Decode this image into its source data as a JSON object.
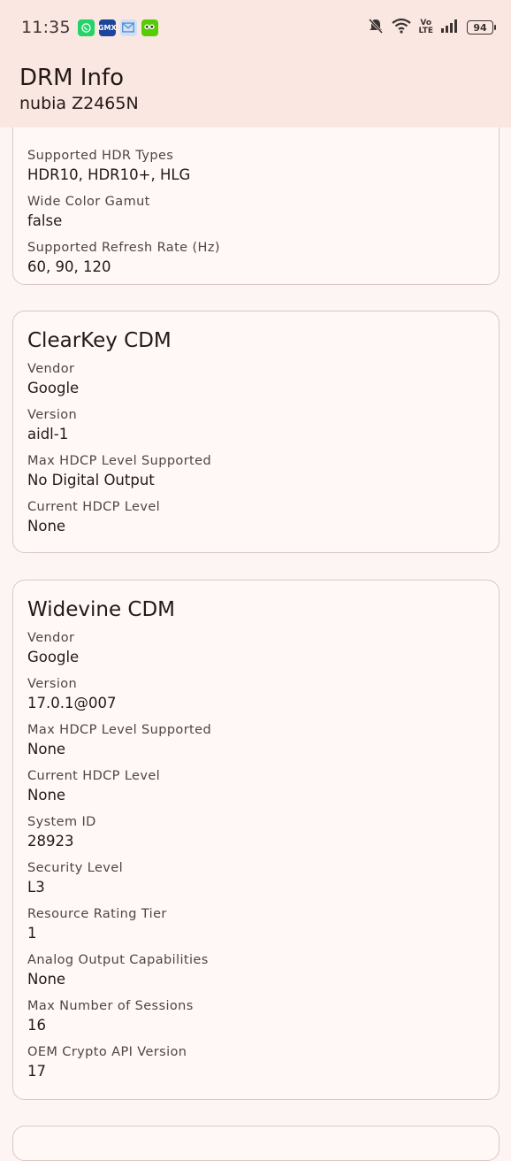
{
  "status_bar": {
    "time": "11:35",
    "battery": "94",
    "network_badge": "Vo\nLTE",
    "notification_icons": [
      "whatsapp-icon",
      "gmx-icon",
      "mail-icon",
      "duolingo-icon"
    ]
  },
  "app_bar": {
    "title": "DRM Info",
    "subtitle": "nubia Z2465N"
  },
  "display_card": {
    "fields": [
      {
        "label": "Supported HDR Types",
        "value": "HDR10, HDR10+, HLG"
      },
      {
        "label": "Wide Color Gamut",
        "value": "false"
      },
      {
        "label": "Supported Refresh Rate (Hz)",
        "value": "60, 90, 120"
      }
    ]
  },
  "clearkey_card": {
    "title": "ClearKey CDM",
    "fields": [
      {
        "label": "Vendor",
        "value": "Google"
      },
      {
        "label": "Version",
        "value": "aidl-1"
      },
      {
        "label": "Max HDCP Level Supported",
        "value": "No Digital Output"
      },
      {
        "label": "Current HDCP Level",
        "value": "None"
      }
    ]
  },
  "widevine_card": {
    "title": "Widevine CDM",
    "fields": [
      {
        "label": "Vendor",
        "value": "Google"
      },
      {
        "label": "Version",
        "value": "17.0.1@007"
      },
      {
        "label": "Max HDCP Level Supported",
        "value": "None"
      },
      {
        "label": "Current HDCP Level",
        "value": "None"
      },
      {
        "label": "System ID",
        "value": "28923"
      },
      {
        "label": "Security Level",
        "value": "L3"
      },
      {
        "label": "Resource Rating Tier",
        "value": "1"
      },
      {
        "label": "Analog Output Capabilities",
        "value": "None"
      },
      {
        "label": "Max Number of Sessions",
        "value": "16"
      },
      {
        "label": "OEM Crypto API Version",
        "value": "17"
      }
    ]
  }
}
